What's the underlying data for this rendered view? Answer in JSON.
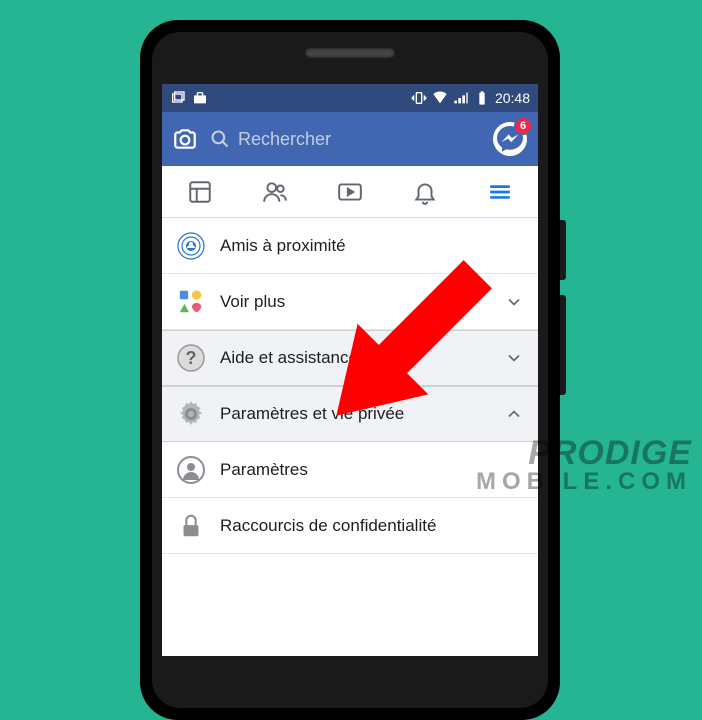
{
  "status": {
    "time": "20:48"
  },
  "search": {
    "placeholder": "Rechercher"
  },
  "messenger": {
    "badge": "6"
  },
  "menu": {
    "nearby": "Amis à proximité",
    "seeMore": "Voir plus",
    "help": "Aide et assistance",
    "settingsPrivacy": "Paramètres et vie privée",
    "settings": "Paramètres",
    "shortcuts": "Raccourcis de confidentialité"
  },
  "watermark": {
    "line1": "PRODIGE",
    "line2": "MOBILE.COM"
  }
}
